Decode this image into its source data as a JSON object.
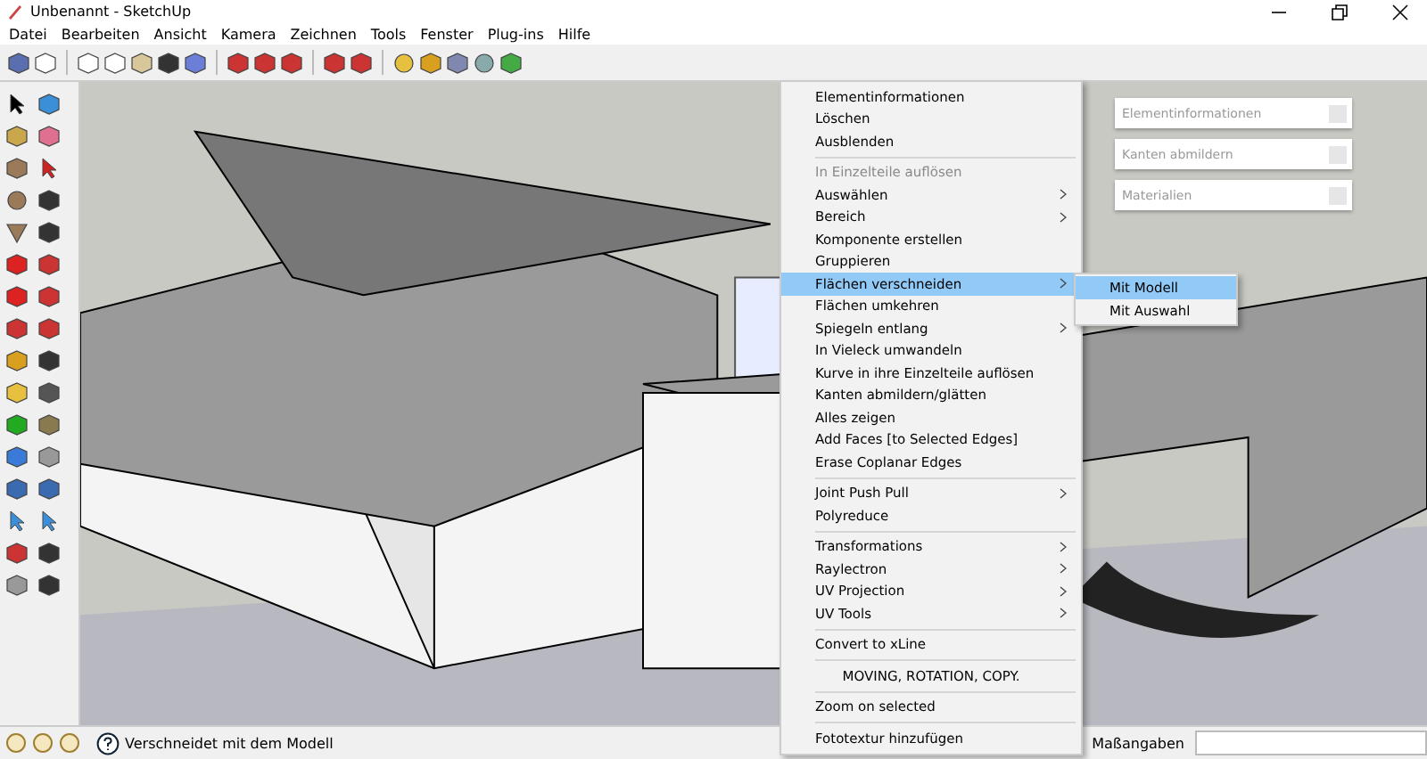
{
  "window": {
    "title": "Unbenannt - SketchUp"
  },
  "menu_bar": [
    "Datei",
    "Bearbeiten",
    "Ansicht",
    "Kamera",
    "Zeichnen",
    "Tools",
    "Fenster",
    "Plug-ins",
    "Hilfe"
  ],
  "context_menu": [
    {
      "kind": "item",
      "label": "Elementinformationen",
      "submenu": false,
      "disabled": false,
      "selected": false
    },
    {
      "kind": "item",
      "label": "Löschen",
      "submenu": false,
      "disabled": false,
      "selected": false
    },
    {
      "kind": "item",
      "label": "Ausblenden",
      "submenu": false,
      "disabled": false,
      "selected": false
    },
    {
      "kind": "separator"
    },
    {
      "kind": "item",
      "label": "In Einzelteile auflösen",
      "submenu": false,
      "disabled": true,
      "selected": false
    },
    {
      "kind": "item",
      "label": "Auswählen",
      "submenu": true,
      "disabled": false,
      "selected": false
    },
    {
      "kind": "item",
      "label": "Bereich",
      "submenu": true,
      "disabled": false,
      "selected": false
    },
    {
      "kind": "item",
      "label": "Komponente erstellen",
      "submenu": false,
      "disabled": false,
      "selected": false
    },
    {
      "kind": "item",
      "label": "Gruppieren",
      "submenu": false,
      "disabled": false,
      "selected": false
    },
    {
      "kind": "item",
      "label": "Flächen verschneiden",
      "submenu": true,
      "disabled": false,
      "selected": true
    },
    {
      "kind": "item",
      "label": "Flächen umkehren",
      "submenu": false,
      "disabled": false,
      "selected": false
    },
    {
      "kind": "item",
      "label": "Spiegeln entlang",
      "submenu": true,
      "disabled": false,
      "selected": false
    },
    {
      "kind": "item",
      "label": "In Vieleck umwandeln",
      "submenu": false,
      "disabled": false,
      "selected": false
    },
    {
      "kind": "item",
      "label": "Kurve in ihre Einzelteile auflösen",
      "submenu": false,
      "disabled": false,
      "selected": false
    },
    {
      "kind": "item",
      "label": "Kanten abmildern/glätten",
      "submenu": false,
      "disabled": false,
      "selected": false
    },
    {
      "kind": "item",
      "label": "Alles zeigen",
      "submenu": false,
      "disabled": false,
      "selected": false
    },
    {
      "kind": "item",
      "label": "Add Faces [to Selected Edges]",
      "submenu": false,
      "disabled": false,
      "selected": false
    },
    {
      "kind": "item",
      "label": "Erase Coplanar Edges",
      "submenu": false,
      "disabled": false,
      "selected": false
    },
    {
      "kind": "separator"
    },
    {
      "kind": "item",
      "label": "Joint Push Pull",
      "submenu": true,
      "disabled": false,
      "selected": false
    },
    {
      "kind": "item",
      "label": "Polyreduce",
      "submenu": false,
      "disabled": false,
      "selected": false
    },
    {
      "kind": "separator"
    },
    {
      "kind": "item",
      "label": "Transformations",
      "submenu": true,
      "disabled": false,
      "selected": false
    },
    {
      "kind": "item",
      "label": "Raylectron",
      "submenu": true,
      "disabled": false,
      "selected": false
    },
    {
      "kind": "item",
      "label": "UV Projection",
      "submenu": true,
      "disabled": false,
      "selected": false
    },
    {
      "kind": "item",
      "label": "UV Tools",
      "submenu": true,
      "disabled": false,
      "selected": false
    },
    {
      "kind": "separator"
    },
    {
      "kind": "item",
      "label": "Convert to xLine",
      "submenu": false,
      "disabled": false,
      "selected": false
    },
    {
      "kind": "separator"
    },
    {
      "kind": "heading",
      "label": "MOVING, ROTATION, COPY."
    },
    {
      "kind": "separator"
    },
    {
      "kind": "item",
      "label": "Zoom on selected",
      "submenu": false,
      "disabled": false,
      "selected": false
    },
    {
      "kind": "separator"
    },
    {
      "kind": "item",
      "label": "Fototextur hinzufügen",
      "submenu": false,
      "disabled": false,
      "selected": false
    }
  ],
  "submenu": [
    {
      "label": "Mit Modell",
      "selected": true
    },
    {
      "label": "Mit Auswahl",
      "selected": false
    }
  ],
  "tray_panels": [
    "Elementinformationen",
    "Kanten abmildern",
    "Materialien"
  ],
  "status_bar": {
    "message": "Verschneidet mit dem Modell",
    "measurements_label": "Maßangaben"
  }
}
